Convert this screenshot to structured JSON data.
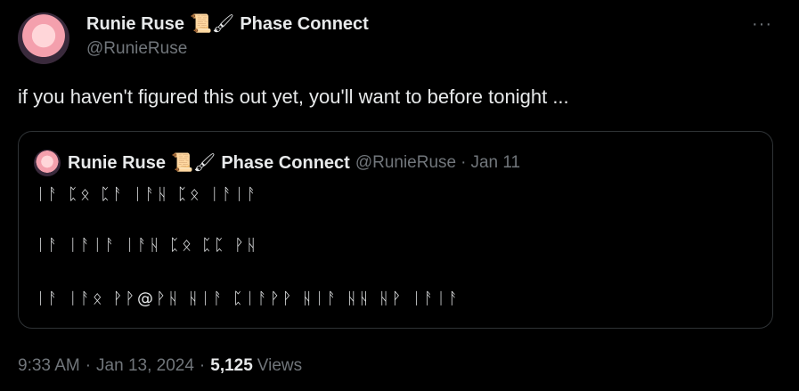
{
  "author": {
    "display_name": "Runie Ruse",
    "emojis": "📜🖌",
    "affiliation": "Phase Connect",
    "handle": "@RunieRuse"
  },
  "more_icon": "···",
  "tweet_text": "if you haven't figured this out yet, you'll want to before tonight ...",
  "quote": {
    "display_name": "Runie Ruse",
    "emojis": "📜🖌",
    "affiliation": "Phase Connect",
    "handle": "@RunieRuse",
    "separator": "·",
    "date": "Jan 11",
    "lines": [
      "ᛁᚨ ᛈᛟ ᛈᚨ ᛁᚨᚺ ᛈᛟ ᛁᚨᛁᚨ",
      "ᛁᚨ ᛁᚨᛁᚨ ᛁᚨᚺ ᛈᛟ ᛈᛈ ᚹᚺ",
      "ᛁᚨ ᛁᚨᛟ ᚹᚹ@ᚹᚺ ᚺᛁᚨ ᛈᛁᚨᚹᚹ ᚺᛁᚨ ᚺᚺ ᚺᚹ ᛁᚨᛁᚨ"
    ]
  },
  "footer": {
    "time": "9:33 AM",
    "separator": "·",
    "date": "Jan 13, 2024",
    "views_count": "5,125",
    "views_label": "Views"
  }
}
